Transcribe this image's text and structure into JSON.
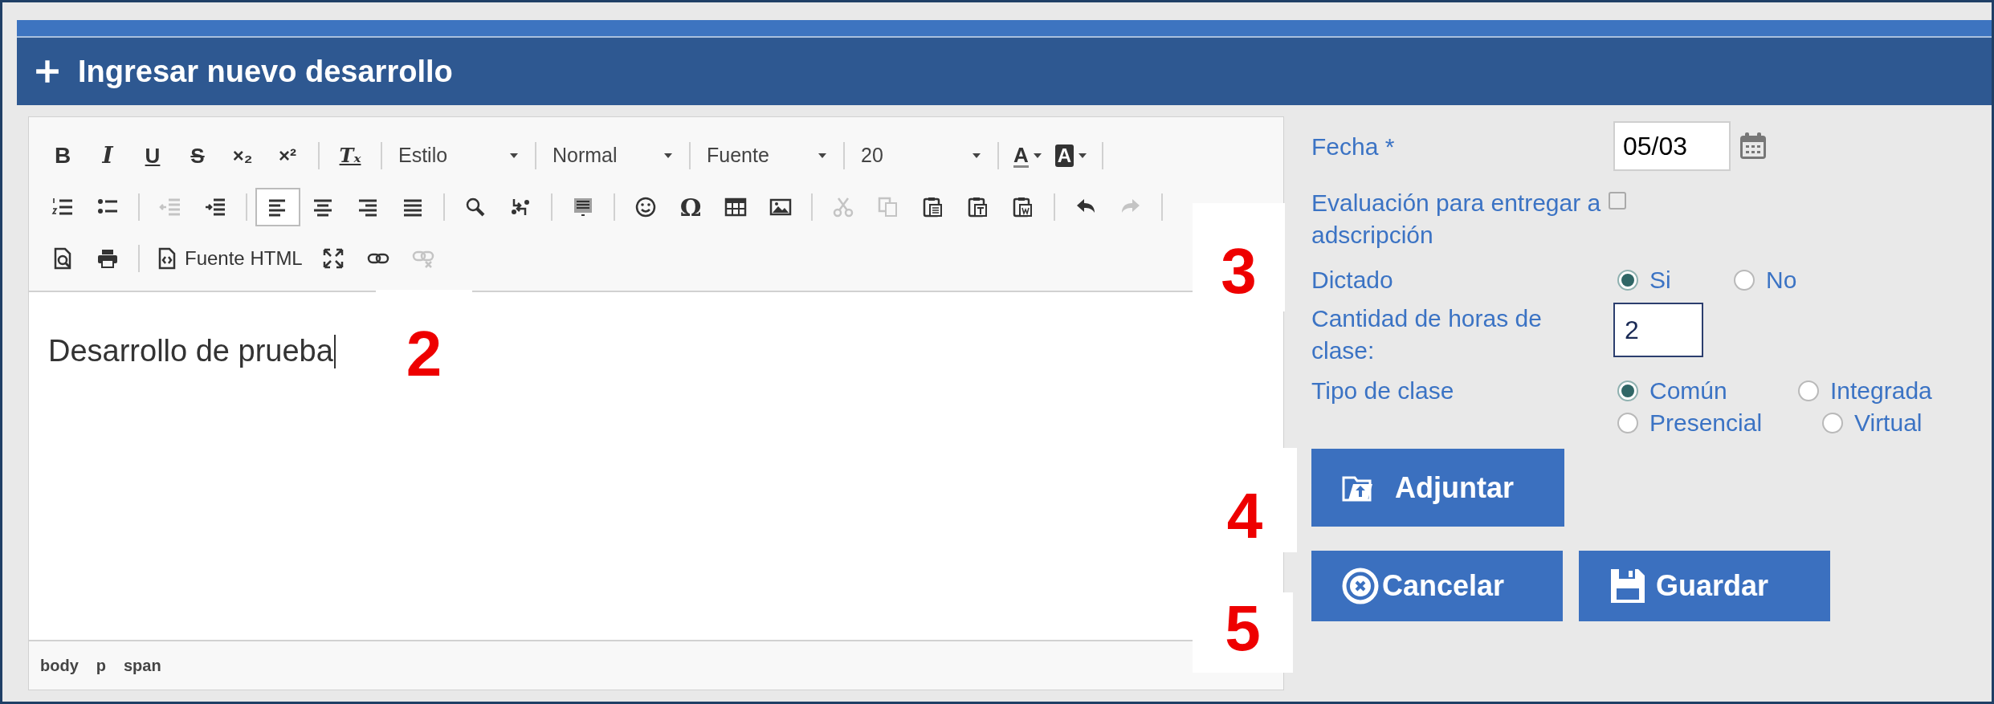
{
  "panel": {
    "title": "Ingresar nuevo desarrollo"
  },
  "toolbar": [
    [
      {
        "kind": "button",
        "glyph": "B",
        "disabled": false,
        "selected": false
      },
      {
        "kind": "button",
        "glyph": "I",
        "disabled": false,
        "selected": false
      },
      {
        "kind": "button",
        "glyph": "U",
        "disabled": false,
        "selected": false
      },
      {
        "kind": "button",
        "glyph": "S",
        "disabled": false,
        "selected": false
      },
      {
        "kind": "button",
        "glyph": "×₂",
        "disabled": false,
        "selected": false
      },
      {
        "kind": "button",
        "glyph": "×²",
        "disabled": false,
        "selected": false
      },
      {
        "kind": "separator"
      },
      {
        "kind": "button",
        "glyph": "Tₓ",
        "disabled": false,
        "selected": false
      },
      {
        "kind": "separator"
      },
      {
        "kind": "dropdown",
        "label": "Estilo"
      },
      {
        "kind": "separator"
      },
      {
        "kind": "dropdown",
        "label": "Normal"
      },
      {
        "kind": "separator"
      },
      {
        "kind": "dropdown",
        "label": "Fuente"
      },
      {
        "kind": "separator"
      },
      {
        "kind": "dropdown",
        "label": "20"
      },
      {
        "kind": "separator"
      },
      {
        "kind": "color",
        "glyph": "A"
      },
      {
        "kind": "bgcolor",
        "glyph": "A"
      },
      {
        "kind": "separator"
      }
    ],
    [
      {
        "kind": "button",
        "disabled": false,
        "selected": false
      },
      {
        "kind": "button",
        "disabled": false,
        "selected": false
      },
      {
        "kind": "separator"
      },
      {
        "kind": "button",
        "disabled": true,
        "selected": false
      },
      {
        "kind": "button",
        "disabled": false,
        "selected": false
      },
      {
        "kind": "separator"
      },
      {
        "kind": "button",
        "disabled": false,
        "selected": true
      },
      {
        "kind": "button",
        "disabled": false,
        "selected": false
      },
      {
        "kind": "button",
        "disabled": false,
        "selected": false
      },
      {
        "kind": "button",
        "disabled": false,
        "selected": false
      },
      {
        "kind": "separator"
      },
      {
        "kind": "button",
        "disabled": false,
        "selected": false
      },
      {
        "kind": "button",
        "disabled": false,
        "selected": false
      },
      {
        "kind": "separator"
      },
      {
        "kind": "button",
        "disabled": false,
        "selected": false
      },
      {
        "kind": "separator"
      },
      {
        "kind": "button",
        "disabled": false,
        "selected": false
      },
      {
        "kind": "button",
        "glyph": "Ω",
        "disabled": false,
        "selected": false
      },
      {
        "kind": "button",
        "disabled": false,
        "selected": false
      },
      {
        "kind": "button",
        "disabled": false,
        "selected": false
      },
      {
        "kind": "separator"
      },
      {
        "kind": "button",
        "disabled": true,
        "selected": false
      },
      {
        "kind": "button",
        "disabled": true,
        "selected": false
      },
      {
        "kind": "button",
        "disabled": false,
        "selected": false
      },
      {
        "kind": "button",
        "disabled": false,
        "selected": false
      },
      {
        "kind": "button",
        "disabled": false,
        "selected": false
      },
      {
        "kind": "separator"
      },
      {
        "kind": "button",
        "disabled": false,
        "selected": false
      },
      {
        "kind": "button",
        "disabled": true,
        "selected": false
      },
      {
        "kind": "separator"
      }
    ],
    [
      {
        "kind": "button",
        "disabled": false,
        "selected": false
      },
      {
        "kind": "button",
        "disabled": false,
        "selected": false
      },
      {
        "kind": "separator"
      },
      {
        "kind": "text_button",
        "label": "Fuente HTML",
        "disabled": false,
        "selected": false
      },
      {
        "kind": "button",
        "disabled": false,
        "selected": false
      },
      {
        "kind": "button",
        "disabled": false,
        "selected": false
      },
      {
        "kind": "button",
        "disabled": true,
        "selected": false
      }
    ]
  ],
  "editor": {
    "content": "Desarrollo de prueba",
    "path": [
      "body",
      "p",
      "span"
    ]
  },
  "form": {
    "fecha": {
      "label": "Fecha *",
      "value": "05/03"
    },
    "evaluacion": {
      "label": "Evaluación para entregar a adscripción",
      "checked": false
    },
    "dictado": {
      "label": "Dictado",
      "options": [
        {
          "label": "Si",
          "selected": true
        },
        {
          "label": "No",
          "selected": false
        }
      ]
    },
    "horas": {
      "label": "Cantidad de horas de clase:",
      "value": "2"
    },
    "tipo": {
      "label": "Tipo de clase",
      "options": [
        {
          "label": "Común",
          "selected": true
        },
        {
          "label": "Integrada",
          "selected": false
        },
        {
          "label": "Presencial",
          "selected": false
        },
        {
          "label": "Virtual",
          "selected": false
        }
      ]
    }
  },
  "buttons": {
    "attach": "Adjuntar",
    "cancel": "Cancelar",
    "save": "Guardar"
  },
  "annotations": [
    "2",
    "3",
    "4",
    "5"
  ]
}
